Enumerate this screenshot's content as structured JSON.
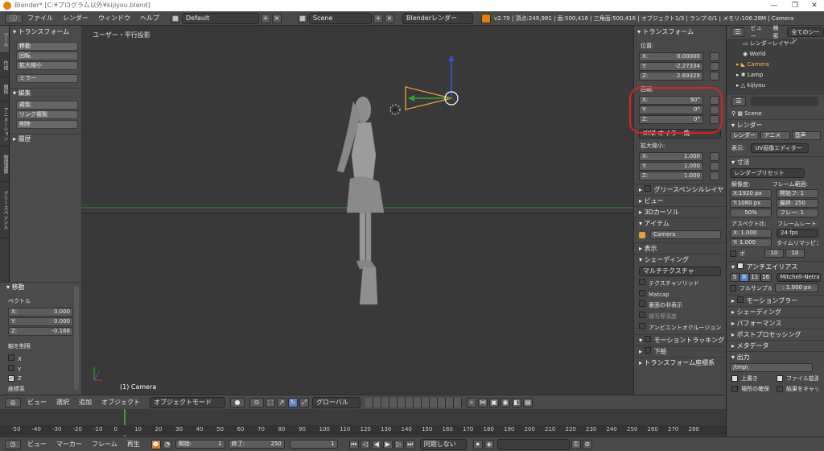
{
  "window": {
    "title": "Blender* [C:¥プログラム以外¥kijiyou.blend]",
    "minimize": "—",
    "maximize": "❐",
    "close": "✕"
  },
  "info_header": {
    "menus": [
      "ファイル",
      "レンダー",
      "ウィンドウ",
      "ヘルプ"
    ],
    "screen_layout": "Default",
    "scene": "Scene",
    "render_engine": "Blenderレンダー",
    "stats": "v2.79 | 頂点:249,981 | 面:500,416 | 三角面:500,416 | オブジェクト1/3 | ランプ:0/1 | メモリ:106.28M | Camera"
  },
  "tool_tabs": [
    "ツール",
    "作成",
    "関係",
    "アニメーション",
    "物理演算",
    "グリースペンシル"
  ],
  "toolshelf": {
    "transform_header": "トランスフォーム",
    "transform_buttons": [
      "移動",
      "回転",
      "拡大縮小"
    ],
    "mirror_button": "ミラー",
    "edit_header": "編集",
    "edit_buttons": [
      "複製",
      "リンク複製",
      "削除"
    ],
    "history_header": "履歴"
  },
  "redo_panel": {
    "header": "移動",
    "vector_label": "ベクトル",
    "vector": [
      {
        "axis": "X:",
        "value": "0.000"
      },
      {
        "axis": "Y:",
        "value": "0.000"
      },
      {
        "axis": "Z:",
        "value": "-0.168"
      }
    ],
    "constraint_label": "軸を制限",
    "constraint_axes": [
      "X",
      "Y",
      "Z"
    ],
    "orientation_label": "座標系"
  },
  "viewport": {
    "view_label": "ユーザー・平行投影",
    "object_label": "(1) Camera"
  },
  "npanel": {
    "transform_header": "トランスフォーム",
    "location_label": "位置:",
    "location": [
      {
        "axis": "X:",
        "value": "0.00000"
      },
      {
        "axis": "Y:",
        "value": "-2.27334"
      },
      {
        "axis": "Z:",
        "value": "2.69329"
      }
    ],
    "rotation_label": "回転:",
    "rotation": [
      {
        "axis": "X:",
        "value": "90°"
      },
      {
        "axis": "Y:",
        "value": "0°"
      },
      {
        "axis": "Z:",
        "value": "0°"
      }
    ],
    "rotation_mode": "XYZ オイラー角",
    "scale_label": "拡大縮小:",
    "scale": [
      {
        "axis": "X:",
        "value": "1.000"
      },
      {
        "axis": "Y:",
        "value": "1.000"
      },
      {
        "axis": "Z:",
        "value": "1.000"
      }
    ],
    "sections_a": [
      "グリースペンシルレイヤ",
      "ビュー",
      "3Dカーソル",
      "アイテム"
    ],
    "item_name": "Camera",
    "sections_b": [
      "表示",
      "シェーディング"
    ],
    "shading_mode": "マルチテクスチャ",
    "shading_options": [
      "テクスチャソリッド",
      "Matcap",
      "裏面の非表示",
      "被写界深度",
      "アンビエントオクルージョン"
    ],
    "sections_c": [
      "モーショントラッキング",
      "下絵",
      "トランスフォーム座標系"
    ]
  },
  "outliner": {
    "header_items": [
      "ビュー",
      "検索",
      "全てのシーン"
    ],
    "rows": [
      "レンダーレイヤー",
      "World",
      "Camera",
      "Lamp",
      "kijiyou"
    ]
  },
  "properties": {
    "scene_label": "Scene",
    "render_header": "レンダー",
    "render_buttons": [
      "レンダー",
      "アニメ",
      "音声"
    ],
    "display_label": "表示:",
    "display_value": "UV画像エディター",
    "dimensions_header": "寸法",
    "render_presets": "レンダープリセット",
    "resolution_label": "解像度:",
    "res_x": "X:1920 px",
    "res_y": "Y:1080 px",
    "res_pct": "50%",
    "frame_range_label": "フレーム範囲:",
    "frame_start": "開始フ: 1",
    "frame_end": "最終: 250",
    "frame_step": "フレー: 1",
    "aspect_label": "アスペクト比:",
    "aspect_x": "X: 1.000",
    "aspect_y": "Y: 1.000",
    "framerate_label": "フレームレート:",
    "framerate": "24 fps",
    "time_remap_label": "タイムリマッピング:",
    "remap_old": "10",
    "remap_new": "10",
    "border_label": "ボ",
    "aa_header": "アンチエイリアス",
    "aa_samples": [
      "5",
      "8",
      "11",
      "16"
    ],
    "aa_filter": "Mitchell-Netravali",
    "full_sample": "フルサンプル",
    "filter_size": ": 1.000 px",
    "sections": [
      "モーションブラー",
      "シェーディング",
      "パフォーマンス",
      "ポストプロセッシング",
      "メタデータ"
    ],
    "output_header": "出力",
    "output_path": "/tmp\\",
    "overwrite": "上書き",
    "file_ext": "ファイル拡張子",
    "placeholders": "場所の確保",
    "cache": "結果をキャッシュ"
  },
  "viewport_header": {
    "menus": [
      "ビュー",
      "選択",
      "追加",
      "オブジェクト"
    ],
    "mode": "オブジェクトモード",
    "orientation": "グローバル"
  },
  "timeline": {
    "ticks": [
      "-50",
      "-40",
      "-30",
      "-20",
      "-10",
      "0",
      "10",
      "20",
      "30",
      "40",
      "50",
      "60",
      "70",
      "80",
      "90",
      "100",
      "110",
      "120",
      "130",
      "140",
      "150",
      "160",
      "170",
      "180",
      "190",
      "200",
      "210",
      "220",
      "230",
      "240",
      "250",
      "260",
      "270",
      "280"
    ],
    "menus": [
      "ビュー",
      "マーカー",
      "フレーム",
      "再生"
    ],
    "start": "開始:",
    "start_value": "1",
    "end": "終了:",
    "end_value": "250",
    "current": "1",
    "sync": "同期しない"
  },
  "colors": {
    "accent": "#e87d0d",
    "highlight_circle": "#e02020",
    "selected_blue": "#5680c2"
  }
}
